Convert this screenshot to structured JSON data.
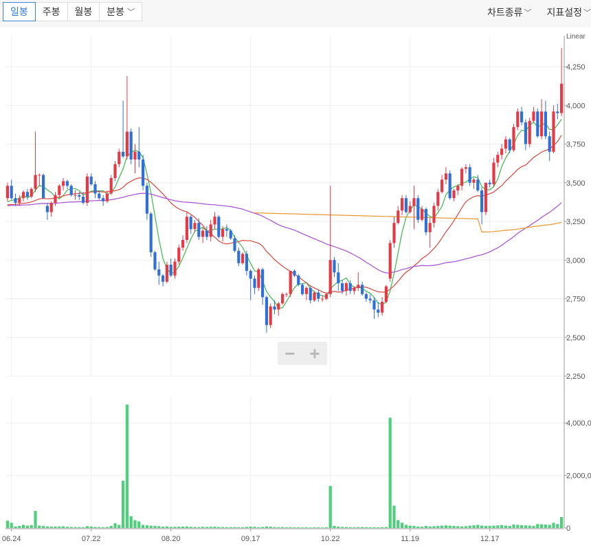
{
  "period_tabs": [
    {
      "label": "일봉",
      "active": true,
      "dropdown": false
    },
    {
      "label": "주봉",
      "active": false,
      "dropdown": false
    },
    {
      "label": "월봉",
      "active": false,
      "dropdown": false
    },
    {
      "label": "분봉",
      "active": false,
      "dropdown": true
    }
  ],
  "menu": {
    "chart_type": "차트종류",
    "indicator_settings": "지표설정"
  },
  "zoom": {
    "minus": "−",
    "plus": "+"
  },
  "colors": {
    "up": "#e63946",
    "down": "#2f6fd6",
    "ma5": "#3cb84a",
    "ma20": "#d9453b",
    "ma60": "#a64dd6",
    "ma120": "#e8962e",
    "volume": "#4cd07a"
  },
  "chart_data": {
    "type": "candlestick",
    "scale_label": "Linear",
    "price_ylim": [
      2250,
      4450
    ],
    "price_ticks": [
      "4,250",
      "4,000",
      "3,750",
      "3,500",
      "3,250",
      "3,000",
      "2,750",
      "2,500",
      "2,250"
    ],
    "volume_ticks": [
      "4,000,0",
      "2,000,0",
      "0"
    ],
    "volume_tick_values": [
      4000000,
      2000000,
      0
    ],
    "volume_ylim": [
      0,
      5000000
    ],
    "x_labels": [
      {
        "index": 1,
        "label": "06.24"
      },
      {
        "index": 21,
        "label": "07.22"
      },
      {
        "index": 41,
        "label": "08.20"
      },
      {
        "index": 61,
        "label": "09.17"
      },
      {
        "index": 81,
        "label": "10.22"
      },
      {
        "index": 101,
        "label": "11.19"
      },
      {
        "index": 121,
        "label": "12.17"
      }
    ],
    "candles": [
      [
        3400,
        3500,
        3380,
        3480
      ],
      [
        3480,
        3520,
        3390,
        3400
      ],
      [
        3400,
        3430,
        3350,
        3370
      ],
      [
        3370,
        3420,
        3350,
        3400
      ],
      [
        3400,
        3450,
        3380,
        3440
      ],
      [
        3440,
        3460,
        3390,
        3410
      ],
      [
        3410,
        3470,
        3400,
        3460
      ],
      [
        3460,
        3830,
        3440,
        3550
      ],
      [
        3550,
        3560,
        3480,
        3550
      ],
      [
        3550,
        3560,
        3400,
        3400
      ],
      [
        3350,
        3370,
        3260,
        3310
      ],
      [
        3310,
        3380,
        3280,
        3370
      ],
      [
        3370,
        3440,
        3350,
        3420
      ],
      [
        3420,
        3490,
        3400,
        3480
      ],
      [
        3480,
        3530,
        3450,
        3510
      ],
      [
        3510,
        3520,
        3460,
        3480
      ],
      [
        3480,
        3490,
        3410,
        3420
      ],
      [
        3420,
        3450,
        3390,
        3420
      ],
      [
        3420,
        3440,
        3390,
        3410
      ],
      [
        3410,
        3440,
        3360,
        3370
      ],
      [
        3370,
        3560,
        3350,
        3540
      ],
      [
        3540,
        3560,
        3480,
        3490
      ],
      [
        3490,
        3510,
        3400,
        3430
      ],
      [
        3430,
        3450,
        3390,
        3400
      ],
      [
        3400,
        3420,
        3350,
        3380
      ],
      [
        3380,
        3450,
        3370,
        3430
      ],
      [
        3430,
        3550,
        3420,
        3530
      ],
      [
        3530,
        3640,
        3510,
        3620
      ],
      [
        3620,
        3720,
        3600,
        3700
      ],
      [
        3700,
        4030,
        3660,
        3670
      ],
      [
        3670,
        4190,
        3650,
        3830
      ],
      [
        3830,
        3850,
        3620,
        3650
      ],
      [
        3650,
        3750,
        3560,
        3700
      ],
      [
        3700,
        3860,
        3600,
        3650
      ],
      [
        3650,
        3680,
        3450,
        3480
      ],
      [
        3480,
        3500,
        3260,
        3300
      ],
      [
        3300,
        3310,
        3020,
        3050
      ],
      [
        3050,
        3060,
        2930,
        2940
      ],
      [
        2940,
        2990,
        2840,
        2900
      ],
      [
        2900,
        2910,
        2830,
        2860
      ],
      [
        2860,
        2990,
        2850,
        2970
      ],
      [
        2970,
        3010,
        2890,
        2900
      ],
      [
        2900,
        3010,
        2880,
        2990
      ],
      [
        2990,
        3100,
        2970,
        3080
      ],
      [
        3080,
        3160,
        3060,
        3130
      ],
      [
        3130,
        3310,
        3110,
        3280
      ],
      [
        3280,
        3290,
        3170,
        3200
      ],
      [
        3200,
        3260,
        3180,
        3240
      ],
      [
        3240,
        3270,
        3130,
        3150
      ],
      [
        3150,
        3210,
        3110,
        3190
      ],
      [
        3190,
        3220,
        3130,
        3150
      ],
      [
        3150,
        3260,
        3120,
        3230
      ],
      [
        3230,
        3310,
        3200,
        3280
      ],
      [
        3280,
        3290,
        3140,
        3150
      ],
      [
        3150,
        3220,
        3120,
        3200
      ],
      [
        3200,
        3230,
        3150,
        3190
      ],
      [
        3190,
        3200,
        3130,
        3140
      ],
      [
        3140,
        3160,
        3050,
        3060
      ],
      [
        3060,
        3080,
        2960,
        2980
      ],
      [
        2980,
        3050,
        2970,
        3040
      ],
      [
        3040,
        3060,
        2900,
        2930
      ],
      [
        2930,
        2940,
        2740,
        2880
      ],
      [
        2880,
        2900,
        2780,
        2820
      ],
      [
        2820,
        2950,
        2800,
        2940
      ],
      [
        2940,
        2950,
        2710,
        2760
      ],
      [
        2760,
        2770,
        2530,
        2580
      ],
      [
        2580,
        2720,
        2560,
        2700
      ],
      [
        2700,
        2740,
        2650,
        2680
      ],
      [
        2680,
        2730,
        2640,
        2720
      ],
      [
        2720,
        2790,
        2710,
        2780
      ],
      [
        2780,
        2790,
        2760,
        2780
      ],
      [
        2780,
        2890,
        2760,
        2930
      ],
      [
        2930,
        2940,
        2890,
        2900
      ],
      [
        2900,
        2910,
        2830,
        2840
      ],
      [
        2840,
        2850,
        2770,
        2780
      ],
      [
        2780,
        2830,
        2740,
        2820
      ],
      [
        2820,
        2830,
        2720,
        2740
      ],
      [
        2740,
        2800,
        2730,
        2790
      ],
      [
        2790,
        2810,
        2730,
        2750
      ],
      [
        2750,
        2770,
        2730,
        2750
      ],
      [
        2750,
        2790,
        2740,
        2780
      ],
      [
        2780,
        3480,
        2760,
        3000
      ],
      [
        3000,
        3020,
        2890,
        2920
      ],
      [
        2920,
        2980,
        2800,
        2850
      ],
      [
        2850,
        2870,
        2780,
        2800
      ],
      [
        2800,
        2860,
        2770,
        2850
      ],
      [
        2850,
        2870,
        2780,
        2800
      ],
      [
        2800,
        2830,
        2780,
        2820
      ],
      [
        2820,
        2920,
        2800,
        2840
      ],
      [
        2840,
        2860,
        2770,
        2780
      ],
      [
        2780,
        2790,
        2730,
        2750
      ],
      [
        2750,
        2780,
        2720,
        2740
      ],
      [
        2740,
        2760,
        2620,
        2680
      ],
      [
        2680,
        2730,
        2630,
        2660
      ],
      [
        2660,
        2760,
        2640,
        2730
      ],
      [
        2730,
        2840,
        2720,
        2830
      ],
      [
        2880,
        3130,
        2860,
        3110
      ],
      [
        3110,
        3280,
        3080,
        3240
      ],
      [
        3240,
        3350,
        3230,
        3320
      ],
      [
        3320,
        3420,
        3290,
        3400
      ],
      [
        3400,
        3420,
        3300,
        3310
      ],
      [
        3310,
        3380,
        3300,
        3350
      ],
      [
        3350,
        3480,
        3200,
        3400
      ],
      [
        3400,
        3420,
        3240,
        3260
      ],
      [
        3260,
        3350,
        3250,
        3330
      ],
      [
        3330,
        3340,
        3160,
        3180
      ],
      [
        3180,
        3270,
        3080,
        3240
      ],
      [
        3240,
        3370,
        3210,
        3350
      ],
      [
        3350,
        3460,
        3320,
        3440
      ],
      [
        3440,
        3550,
        3430,
        3520
      ],
      [
        3520,
        3600,
        3490,
        3560
      ],
      [
        3560,
        3580,
        3390,
        3400
      ],
      [
        3400,
        3460,
        3380,
        3450
      ],
      [
        3450,
        3490,
        3420,
        3480
      ],
      [
        3480,
        3600,
        3450,
        3590
      ],
      [
        3590,
        3620,
        3560,
        3600
      ],
      [
        3600,
        3620,
        3480,
        3500
      ],
      [
        3500,
        3530,
        3460,
        3520
      ],
      [
        3520,
        3550,
        3440,
        3450
      ],
      [
        3450,
        3470,
        3230,
        3310
      ],
      [
        3310,
        3360,
        3290,
        3500
      ],
      [
        3500,
        3520,
        3470,
        3490
      ],
      [
        3490,
        3660,
        3470,
        3630
      ],
      [
        3630,
        3700,
        3600,
        3680
      ],
      [
        3680,
        3750,
        3650,
        3720
      ],
      [
        3720,
        3800,
        3690,
        3780
      ],
      [
        3780,
        3790,
        3690,
        3710
      ],
      [
        3710,
        3880,
        3700,
        3860
      ],
      [
        3860,
        3980,
        3840,
        3960
      ],
      [
        3960,
        3990,
        3870,
        3890
      ],
      [
        3890,
        3910,
        3710,
        3750
      ],
      [
        3750,
        3920,
        3730,
        3900
      ],
      [
        3900,
        3990,
        3890,
        3960
      ],
      [
        3960,
        3980,
        3790,
        3800
      ],
      [
        3800,
        4040,
        3780,
        3960
      ],
      [
        3960,
        4030,
        3780,
        3800
      ],
      [
        3800,
        3830,
        3640,
        3700
      ],
      [
        3700,
        4000,
        3690,
        3960
      ],
      [
        3960,
        4010,
        3910,
        3950
      ],
      [
        3950,
        4370,
        3930,
        4140
      ]
    ],
    "volume": [
      280000,
      200000,
      60000,
      80000,
      120000,
      90000,
      110000,
      650000,
      90000,
      80000,
      60000,
      50000,
      55000,
      60000,
      65000,
      45000,
      40000,
      35000,
      35000,
      30000,
      70000,
      55000,
      40000,
      35000,
      30000,
      40000,
      80000,
      180000,
      120000,
      1800000,
      4700000,
      450000,
      300000,
      250000,
      120000,
      100000,
      90000,
      80000,
      70000,
      50000,
      60000,
      40000,
      45000,
      50000,
      55000,
      60000,
      45000,
      40000,
      35000,
      45000,
      40000,
      45000,
      50000,
      40000,
      35000,
      30000,
      30000,
      35000,
      30000,
      25000,
      40000,
      50000,
      45000,
      30000,
      40000,
      60000,
      50000,
      35000,
      30000,
      35000,
      25000,
      30000,
      25000,
      25000,
      20000,
      25000,
      20000,
      25000,
      25000,
      20000,
      25000,
      1600000,
      80000,
      50000,
      40000,
      35000,
      30000,
      25000,
      30000,
      35000,
      30000,
      25000,
      30000,
      25000,
      30000,
      35000,
      4200000,
      850000,
      300000,
      200000,
      120000,
      90000,
      80000,
      60000,
      50000,
      80000,
      60000,
      70000,
      80000,
      90000,
      100000,
      90000,
      80000,
      70000,
      60000,
      70000,
      90000,
      100000,
      120000,
      90000,
      80000,
      80000,
      90000,
      100000,
      110000,
      90000,
      80000,
      130000,
      120000,
      110000,
      100000,
      90000,
      80000,
      150000,
      140000,
      130000,
      120000,
      200000,
      150000,
      420000
    ],
    "moving_averages": [
      {
        "period": 5,
        "color": "#3cb84a"
      },
      {
        "period": 20,
        "color": "#d9453b"
      },
      {
        "period": 60,
        "color": "#a64dd6"
      },
      {
        "period": 120,
        "color": "#e8962e"
      }
    ]
  }
}
